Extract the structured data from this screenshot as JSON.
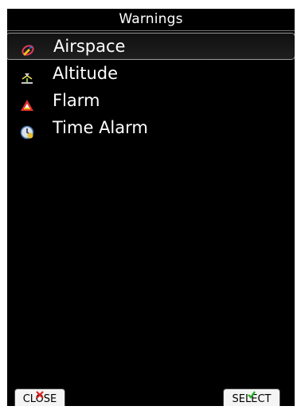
{
  "window": {
    "title": "Warnings"
  },
  "menu": {
    "items": [
      {
        "label": "Airspace",
        "icon": "airspace-icon",
        "selected": true
      },
      {
        "label": "Altitude",
        "icon": "altitude-icon",
        "selected": false
      },
      {
        "label": "Flarm",
        "icon": "flarm-icon",
        "selected": false
      },
      {
        "label": "Time Alarm",
        "icon": "time-alarm-icon",
        "selected": false
      }
    ]
  },
  "softkeys": {
    "close_label": "CLOSE",
    "close_icon": "red-x-icon",
    "select_label": "SELECT",
    "select_icon": "green-check-icon"
  },
  "colors": {
    "background": "#000000",
    "text": "#ffffff",
    "selection_border": "#9a9a9a",
    "close_indicator": "#e02020",
    "select_indicator": "#20b020"
  }
}
